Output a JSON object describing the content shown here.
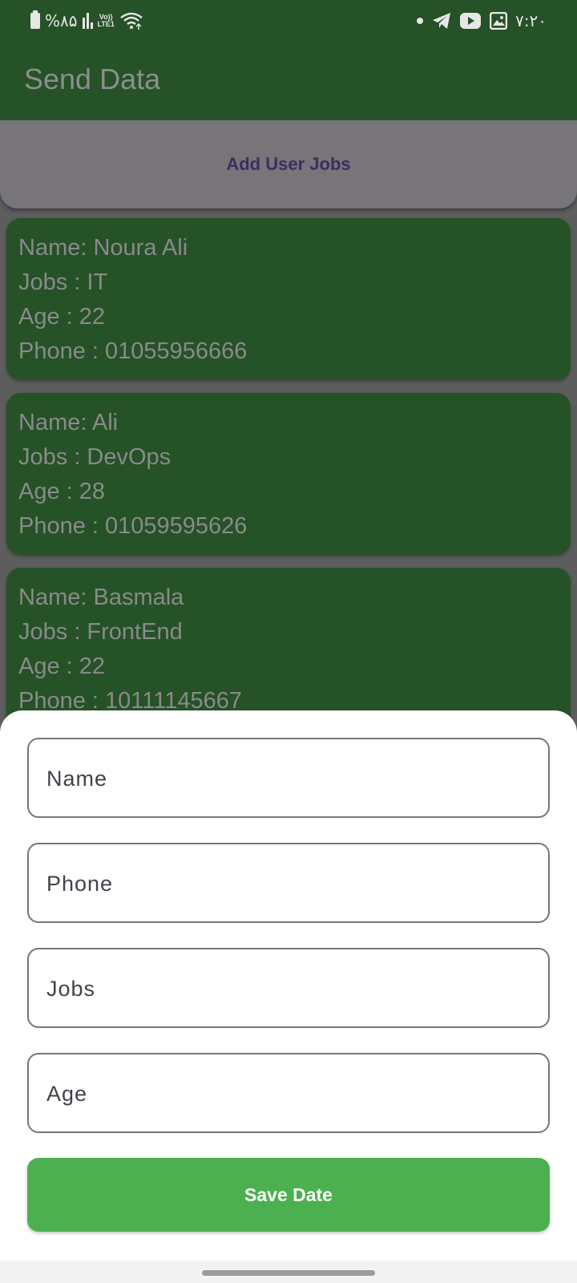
{
  "status_bar": {
    "battery_percent": "%۸۵",
    "network_badge_top": "Vo))",
    "network_badge_bottom": "LTE1",
    "time": "۷:۲۰",
    "icons": [
      "battery-icon",
      "signal-icon",
      "wifi-icon",
      "notification-dot-icon",
      "telegram-icon",
      "youtube-icon",
      "gallery-icon"
    ]
  },
  "app_bar": {
    "title": "Send Data"
  },
  "add_button": {
    "label": "Add User Jobs"
  },
  "users": [
    {
      "name_line": "Name: Noura Ali",
      "jobs_line": "Jobs : IT",
      "age_line": "Age : 22",
      "phone_line": "Phone : 01055956666"
    },
    {
      "name_line": "Name: Ali",
      "jobs_line": "Jobs : DevOps",
      "age_line": "Age : 28",
      "phone_line": "Phone : 01059595626"
    },
    {
      "name_line": "Name: Basmala",
      "jobs_line": "Jobs : FrontEnd",
      "age_line": "Age : 22",
      "phone_line": "Phone : 10111145667"
    }
  ],
  "form": {
    "name_placeholder": "Name",
    "phone_placeholder": "Phone",
    "jobs_placeholder": "Jobs",
    "age_placeholder": "Age",
    "name_value": "",
    "phone_value": "",
    "jobs_value": "",
    "age_value": "",
    "save_label": "Save Date"
  },
  "colors": {
    "app_bar": "#255227",
    "card": "#255227",
    "save_button": "#4cb050",
    "add_button": "#777579",
    "sheet": "#ffffff"
  }
}
